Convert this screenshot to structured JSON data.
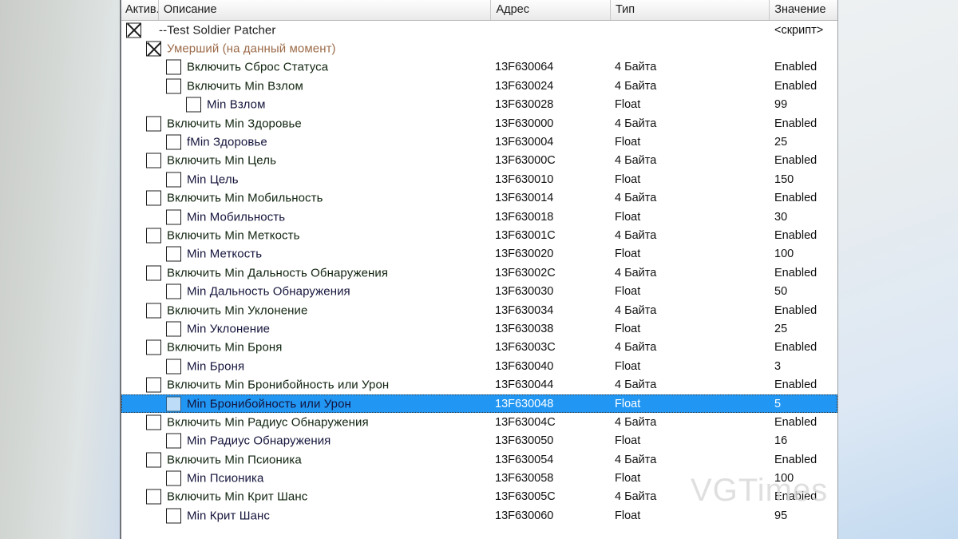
{
  "window": {
    "watermark": "VGTimes"
  },
  "columns": {
    "active": "Актив.",
    "description": "Описание",
    "address": "Адрес",
    "type": "Тип",
    "value": "Значение"
  },
  "colors": {
    "selection": "#2196f3",
    "group_text": "#9c6b49",
    "enable_text": "#10240f",
    "value_text": "#14143c"
  },
  "rows": [
    {
      "indent": 0,
      "checked": true,
      "style": "script",
      "description": "--Test Soldier Patcher",
      "address": "",
      "type": "",
      "value": "<скрипт>",
      "selected": false
    },
    {
      "indent": 1,
      "checked": true,
      "style": "group",
      "description": "Умерший (на данный момент)",
      "address": "",
      "type": "",
      "value": "",
      "selected": false
    },
    {
      "indent": 2,
      "checked": false,
      "style": "enable",
      "description": "Включить Сброс Статуса",
      "address": "13F630064",
      "type": "4 Байта",
      "value": "Enabled",
      "selected": false
    },
    {
      "indent": 2,
      "checked": false,
      "style": "enable",
      "description": "Включить Min Взлом",
      "address": "13F630024",
      "type": "4 Байта",
      "value": "Enabled",
      "selected": false
    },
    {
      "indent": 3,
      "checked": false,
      "style": "value",
      "description": "Min Взлом",
      "address": "13F630028",
      "type": "Float",
      "value": "99",
      "selected": false
    },
    {
      "indent": 1,
      "checked": false,
      "style": "enable",
      "description": "Включить Min Здоровье",
      "address": "13F630000",
      "type": "4 Байта",
      "value": "Enabled",
      "selected": false
    },
    {
      "indent": 2,
      "checked": false,
      "style": "value",
      "description": "fMin Здоровье",
      "address": "13F630004",
      "type": "Float",
      "value": "25",
      "selected": false
    },
    {
      "indent": 1,
      "checked": false,
      "style": "enable",
      "description": "Включить Min Цель",
      "address": "13F63000C",
      "type": "4 Байта",
      "value": "Enabled",
      "selected": false
    },
    {
      "indent": 2,
      "checked": false,
      "style": "value",
      "description": "Min Цель",
      "address": "13F630010",
      "type": "Float",
      "value": "150",
      "selected": false
    },
    {
      "indent": 1,
      "checked": false,
      "style": "enable",
      "description": "Включить Min Мобильность",
      "address": "13F630014",
      "type": "4 Байта",
      "value": "Enabled",
      "selected": false
    },
    {
      "indent": 2,
      "checked": false,
      "style": "value",
      "description": "Min Мобильность",
      "address": "13F630018",
      "type": "Float",
      "value": "30",
      "selected": false
    },
    {
      "indent": 1,
      "checked": false,
      "style": "enable",
      "description": "Включить Min Меткость",
      "address": "13F63001C",
      "type": "4 Байта",
      "value": "Enabled",
      "selected": false
    },
    {
      "indent": 2,
      "checked": false,
      "style": "value",
      "description": "Min Меткость",
      "address": "13F630020",
      "type": "Float",
      "value": "100",
      "selected": false
    },
    {
      "indent": 1,
      "checked": false,
      "style": "enable",
      "description": "Включить Min Дальность Обнаружения",
      "address": "13F63002C",
      "type": "4 Байта",
      "value": "Enabled",
      "selected": false
    },
    {
      "indent": 2,
      "checked": false,
      "style": "value",
      "description": "Min Дальность Обнаружения",
      "address": "13F630030",
      "type": "Float",
      "value": "50",
      "selected": false
    },
    {
      "indent": 1,
      "checked": false,
      "style": "enable",
      "description": "Включить Min Уклонение",
      "address": "13F630034",
      "type": "4 Байта",
      "value": "Enabled",
      "selected": false
    },
    {
      "indent": 2,
      "checked": false,
      "style": "value",
      "description": "Min Уклонение",
      "address": "13F630038",
      "type": "Float",
      "value": "25",
      "selected": false
    },
    {
      "indent": 1,
      "checked": false,
      "style": "enable",
      "description": "Включить Min Броня",
      "address": "13F63003C",
      "type": "4 Байта",
      "value": "Enabled",
      "selected": false
    },
    {
      "indent": 2,
      "checked": false,
      "style": "value",
      "description": "Min Броня",
      "address": "13F630040",
      "type": "Float",
      "value": "3",
      "selected": false
    },
    {
      "indent": 1,
      "checked": false,
      "style": "enable",
      "description": "Включить Min Бронибойность или Урон",
      "address": "13F630044",
      "type": "4 Байта",
      "value": "Enabled",
      "selected": false
    },
    {
      "indent": 2,
      "checked": false,
      "style": "value",
      "description": "Min Бронибойность или Урон",
      "address": "13F630048",
      "type": "Float",
      "value": "5",
      "selected": true
    },
    {
      "indent": 1,
      "checked": false,
      "style": "enable",
      "description": "Включить Min Радиус Обнаружения",
      "address": "13F63004C",
      "type": "4 Байта",
      "value": "Enabled",
      "selected": false
    },
    {
      "indent": 2,
      "checked": false,
      "style": "value",
      "description": "Min Радиус Обнаружения",
      "address": "13F630050",
      "type": "Float",
      "value": "16",
      "selected": false
    },
    {
      "indent": 1,
      "checked": false,
      "style": "enable",
      "description": "Включить Min Псионика",
      "address": "13F630054",
      "type": "4 Байта",
      "value": "Enabled",
      "selected": false
    },
    {
      "indent": 2,
      "checked": false,
      "style": "value",
      "description": "Min Псионика",
      "address": "13F630058",
      "type": "Float",
      "value": "100",
      "selected": false
    },
    {
      "indent": 1,
      "checked": false,
      "style": "enable",
      "description": "Включить Min Крит Шанс",
      "address": "13F63005C",
      "type": "4 Байта",
      "value": "Enabled",
      "selected": false
    },
    {
      "indent": 2,
      "checked": false,
      "style": "value",
      "description": "Min Крит Шанс",
      "address": "13F630060",
      "type": "Float",
      "value": "95",
      "selected": false
    }
  ]
}
